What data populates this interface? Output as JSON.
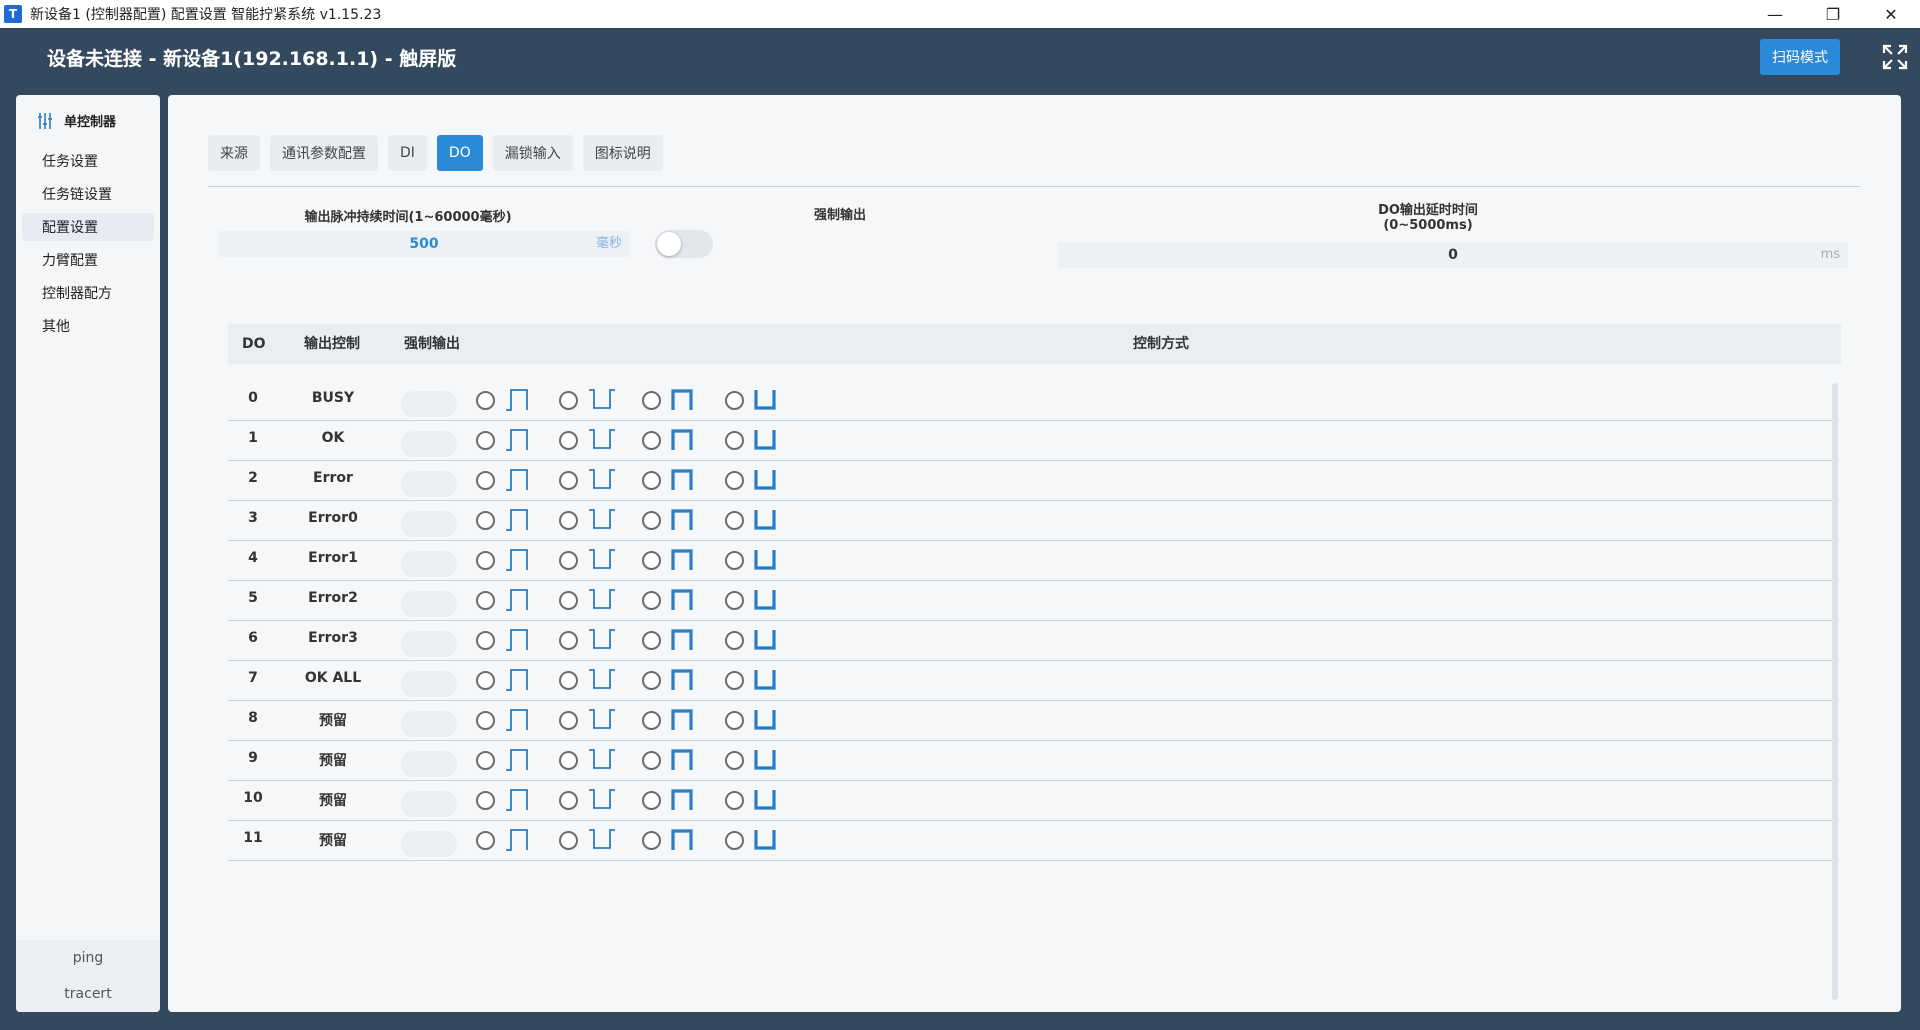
{
  "window": {
    "app_icon_letter": "T",
    "title": "新设备1 (控制器配置) 配置设置 智能拧紧系统 v1.15.23",
    "controls": [
      "—",
      "❐",
      "✕"
    ]
  },
  "header": {
    "title": "设备未连接 - 新设备1(192.168.1.1) - 触屏版",
    "scan_button": "扫码模式",
    "expand_icon": "expand-icon"
  },
  "sidebar": {
    "heading": "单控制器",
    "heading_icon": "sliders-icon",
    "items": [
      {
        "label": "任务设置",
        "active": false
      },
      {
        "label": "任务链设置",
        "active": false
      },
      {
        "label": "配置设置",
        "active": true
      },
      {
        "label": "力臂配置",
        "active": false
      },
      {
        "label": "控制器配方",
        "active": false
      },
      {
        "label": "其他",
        "active": false
      }
    ],
    "bottom": [
      "ping",
      "tracert"
    ]
  },
  "tabs": [
    {
      "label": "来源",
      "active": false
    },
    {
      "label": "通讯参数配置",
      "active": false
    },
    {
      "label": "DI",
      "active": false
    },
    {
      "label": "DO",
      "active": true
    },
    {
      "label": "漏锁输入",
      "active": false
    },
    {
      "label": "图标说明",
      "active": false
    }
  ],
  "config": {
    "pulse_label": "输出脉冲持续时间(1~60000毫秒)",
    "pulse_value": "500",
    "pulse_unit": "毫秒",
    "force_label": "强制输出",
    "force_on": false,
    "delay_label_line1": "DO输出延时时间",
    "delay_label_line2": "(0~5000ms)",
    "delay_value": "0",
    "delay_unit": "ms"
  },
  "table": {
    "headers": {
      "do": "DO",
      "output": "输出控制",
      "force": "强制输出",
      "mode": "控制方式"
    },
    "mode_icons": [
      "pulse-high-icon",
      "pulse-low-icon",
      "level-high-icon",
      "level-low-icon"
    ],
    "rows": [
      {
        "do": "0",
        "name": "BUSY"
      },
      {
        "do": "1",
        "name": "OK"
      },
      {
        "do": "2",
        "name": "Error"
      },
      {
        "do": "3",
        "name": "Error0"
      },
      {
        "do": "4",
        "name": "Error1"
      },
      {
        "do": "5",
        "name": "Error2"
      },
      {
        "do": "6",
        "name": "Error3"
      },
      {
        "do": "7",
        "name": "OK ALL"
      },
      {
        "do": "8",
        "name": "预留"
      },
      {
        "do": "9",
        "name": "预留"
      },
      {
        "do": "10",
        "name": "预留"
      },
      {
        "do": "11",
        "name": "预留"
      }
    ]
  },
  "colors": {
    "header_bg": "#34495e",
    "accent": "#2b8ad8",
    "value_blue": "#2b8ad8",
    "unit_blue": "#7fb3e3",
    "icon_blue": "#2b7cc6"
  }
}
